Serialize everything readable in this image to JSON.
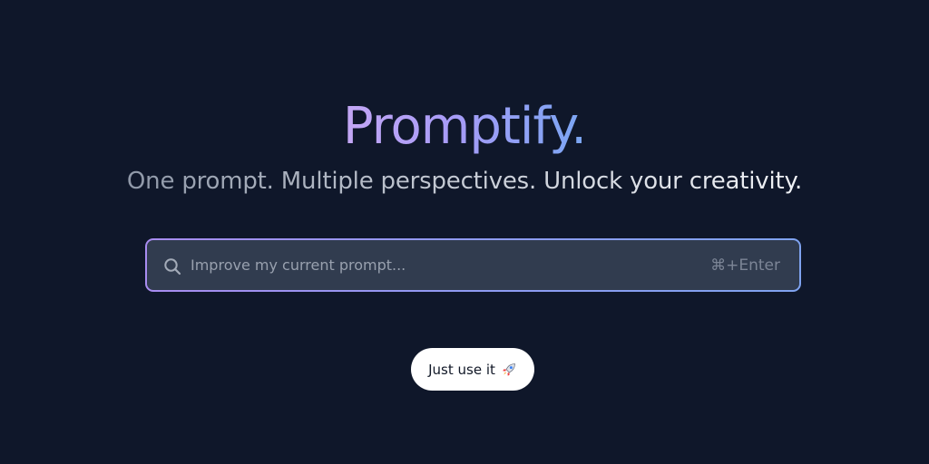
{
  "brand": {
    "title": "Promptify."
  },
  "hero": {
    "subtitle": "One prompt. Multiple perspectives. Unlock your creativity."
  },
  "search": {
    "value": "",
    "placeholder": "Improve my current prompt...",
    "shortcut": "⌘+Enter",
    "icon": "search-icon"
  },
  "cta": {
    "label": "Just use it",
    "icon": "rocket-icon"
  },
  "colors": {
    "background": "#0f172a",
    "input_background": "#313c4f",
    "gradient_start": "#c4a7f5",
    "gradient_end": "#7aa6f3",
    "button_background": "#ffffff"
  }
}
